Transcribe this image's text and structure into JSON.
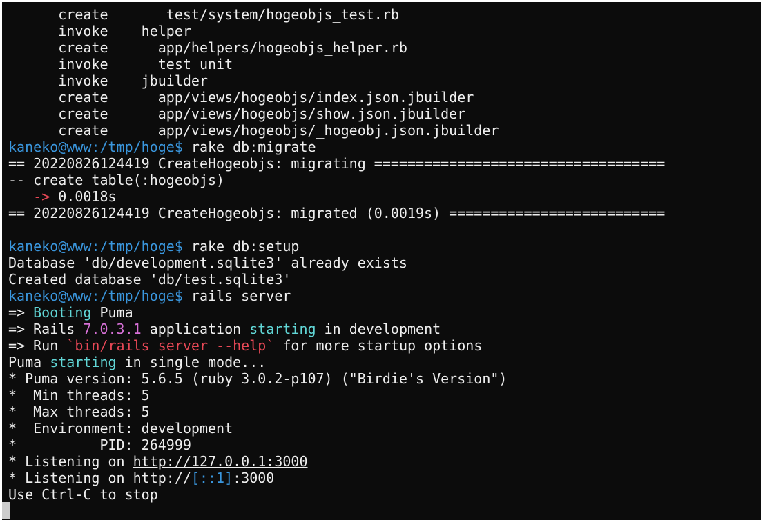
{
  "terminal": {
    "lines": [
      [
        {
          "t": "      create       test/system/hogeobjs_test.rb"
        }
      ],
      [
        {
          "t": "      invoke    helper"
        }
      ],
      [
        {
          "t": "      create      app/helpers/hogeobjs_helper.rb"
        }
      ],
      [
        {
          "t": "      invoke      test_unit"
        }
      ],
      [
        {
          "t": "      invoke    jbuilder"
        }
      ],
      [
        {
          "t": "      create      app/views/hogeobjs/index.json.jbuilder"
        }
      ],
      [
        {
          "t": "      create      app/views/hogeobjs/show.json.jbuilder"
        }
      ],
      [
        {
          "t": "      create      app/views/hogeobjs/_hogeobj.json.jbuilder"
        }
      ],
      [
        {
          "t": "kaneko@www:/tmp/hoge$",
          "c": "prompt"
        },
        {
          "t": " rake db:migrate"
        }
      ],
      [
        {
          "t": "== 20220826124419 CreateHogeobjs: migrating ==================================="
        }
      ],
      [
        {
          "t": "-- create_table(:hogeobjs)"
        }
      ],
      [
        {
          "t": "   -> ",
          "c": "red"
        },
        {
          "t": "0.0018s"
        }
      ],
      [
        {
          "t": "== 20220826124419 CreateHogeobjs: migrated (0.0019s) =========================="
        }
      ],
      [
        {
          "t": ""
        }
      ],
      [
        {
          "t": "kaneko@www:/tmp/hoge$",
          "c": "prompt"
        },
        {
          "t": " rake db:setup"
        }
      ],
      [
        {
          "t": "Database 'db/development.sqlite3' already exists"
        }
      ],
      [
        {
          "t": "Created database 'db/test.sqlite3'"
        }
      ],
      [
        {
          "t": "kaneko@www:/tmp/hoge$",
          "c": "prompt"
        },
        {
          "t": " rails server"
        }
      ],
      [
        {
          "t": "=> "
        },
        {
          "t": "Booting",
          "c": "cyan"
        },
        {
          "t": " Puma"
        }
      ],
      [
        {
          "t": "=> Rails "
        },
        {
          "t": "7.0.3.1",
          "c": "magenta"
        },
        {
          "t": " application "
        },
        {
          "t": "starting",
          "c": "cyan"
        },
        {
          "t": " in development"
        }
      ],
      [
        {
          "t": "=> Run "
        },
        {
          "t": "`bin/rails server --help`",
          "c": "red"
        },
        {
          "t": " for more startup options"
        }
      ],
      [
        {
          "t": "Puma "
        },
        {
          "t": "starting",
          "c": "cyan"
        },
        {
          "t": " in single mode..."
        }
      ],
      [
        {
          "t": "* Puma version: 5.6.5 (ruby 3.0.2-p107) (\"Birdie's Version\")"
        }
      ],
      [
        {
          "t": "*  Min threads: 5"
        }
      ],
      [
        {
          "t": "*  Max threads: 5"
        }
      ],
      [
        {
          "t": "*  Environment: development"
        }
      ],
      [
        {
          "t": "*          PID: 264999"
        }
      ],
      [
        {
          "t": "* Listening on "
        },
        {
          "t": "http://127.0.0.1:3000",
          "c": "link"
        }
      ],
      [
        {
          "t": "* Listening on http://"
        },
        {
          "t": "[::1]",
          "c": "prompt"
        },
        {
          "t": ":3000"
        }
      ],
      [
        {
          "t": "Use Ctrl-C to stop"
        }
      ]
    ]
  },
  "colors": {
    "background": "#0c0c0c",
    "foreground": "#eeeeee",
    "prompt": "#3a96dd",
    "cyan": "#61d6d6",
    "magenta": "#d670d6",
    "red": "#e74856",
    "cursor": "#cccccc"
  }
}
